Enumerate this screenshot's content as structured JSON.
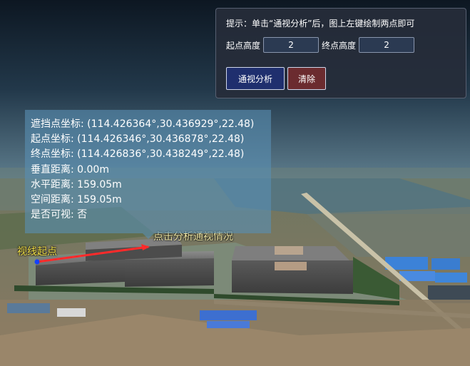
{
  "panel": {
    "hint": "提示：单击“通视分析”后，图上左键绘制两点即可",
    "start_height_label": "起点高度",
    "start_height_value": "2",
    "end_height_label": "终点高度",
    "end_height_value": "2",
    "analyze_label": "通视分析",
    "clear_label": "清除"
  },
  "info": {
    "obstacle": "遮挡点坐标: (114.426364°,30.436929°,22.48)",
    "start": "起点坐标: (114.426346°,30.436878°,22.48)",
    "end": "终点坐标: (114.426836°,30.438249°,22.48)",
    "vertical": "垂直距离: 0.00m",
    "horizontal": "水平距离: 159.05m",
    "spatial": "空间距离: 159.05m",
    "visible": "是否可视: 否"
  },
  "map": {
    "start_label": "视线起点",
    "end_label": "点击分析通视情况"
  },
  "colors": {
    "sight_line": "#ff2a2a",
    "start_point": "#1440ff",
    "label": "#f1e04a"
  }
}
